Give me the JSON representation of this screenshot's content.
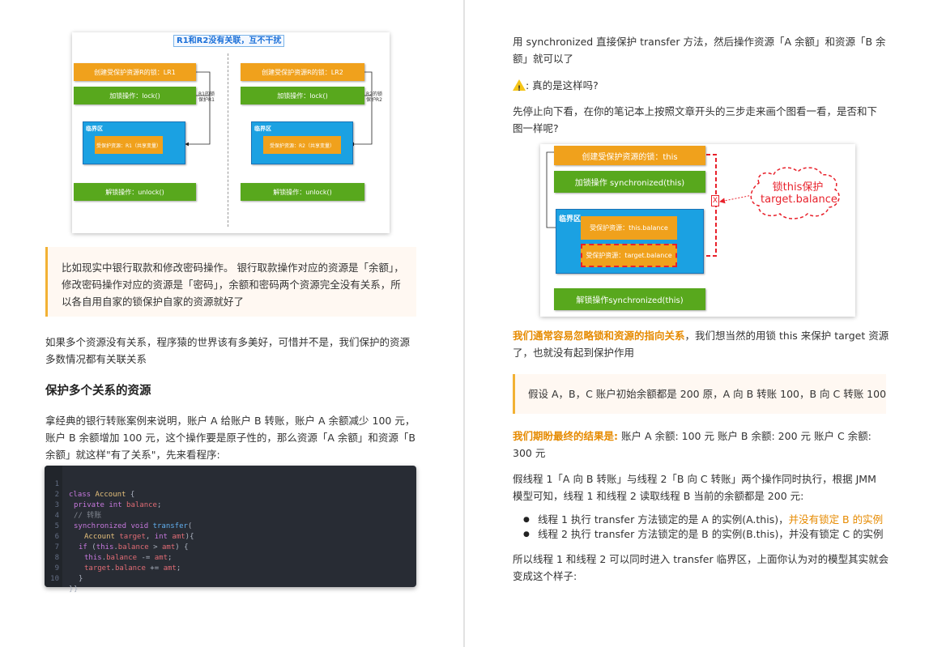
{
  "figure1": {
    "title": "R1和R2没有关联，互不干扰",
    "left": {
      "create_lock": "创建受保护资源R的锁：LR1",
      "lock_op": "加锁操作：lock()",
      "note": [
        "R1的锁",
        "保护R1"
      ],
      "critical": "临界区",
      "resource": "受保护资源：R1（共享变量）",
      "unlock_op": "解锁操作：unlock()"
    },
    "right": {
      "create_lock": "创建受保护资源R的锁：LR2",
      "lock_op": "加锁操作：lock()",
      "note": [
        "R2的锁",
        "保护R2"
      ],
      "critical": "临界区",
      "resource": "受保护资源：R2（共享变量）",
      "unlock_op": "解锁操作：unlock()"
    }
  },
  "quote1": [
    "比如现实中银行取款和修改密码操作。 银行取款操作对应的资源是「余额」，",
    "修改密码操作对应的资源是「密码」，余额和密码两个资源完全没有关系，所",
    "以各自用自家的锁保护自家的资源就好了"
  ],
  "para1": [
    "如果多个资源没有关系，程序猿的世界该有多美好，可惜并不是，我们保护的资源",
    "多数情况都有关联关系"
  ],
  "heading": "保护多个关系的资源",
  "para2": [
    "拿经典的银行转账案例来说明，账户 A 给账户 B 转账，账户 A 余额减少 100 元，",
    "账户 B 余额增加 100 元，这个操作要是原子性的，那么资源「A 余额」和资源「B",
    "余额」就这样\"有了关系\"，先来看程序:"
  ],
  "code": {
    "line_numbers": [
      "1",
      "2",
      "3",
      "4",
      "5",
      "6",
      "7",
      "8",
      "9",
      "10"
    ],
    "l1": [
      "class",
      "Account",
      " {"
    ],
    "l2": [
      "private",
      "int",
      "balance",
      ";"
    ],
    "l3": "// 转账",
    "l4": [
      "synchronized",
      "void",
      "transfer",
      "("
    ],
    "l5": [
      "Account",
      "target",
      ", ",
      "int",
      "amt",
      "){"
    ],
    "l6": [
      "if",
      " (",
      "this",
      ".",
      "balance",
      " > ",
      "amt",
      ") {"
    ],
    "l7": [
      "this",
      ".",
      "balance",
      " -= ",
      "amt",
      ";"
    ],
    "l8": [
      "target",
      ".",
      "balance",
      " += ",
      "amt",
      ";"
    ],
    "l9": "}",
    "l10": "}",
    "l11": "}"
  },
  "right": {
    "para1": [
      "用 synchronized 直接保护 transfer 方法，然后操作资源「A 余额」和资源「B 余",
      "额」就可以了"
    ],
    "question": ": 真的是这样吗?",
    "para2": [
      "先停止向下看，在你的笔记本上按照文章开头的三步走来画个图看一看，是否和下",
      "图一样呢?"
    ],
    "figure2": {
      "create_lock": "创建受保护资源的锁：this",
      "lock_op": "加锁操作 synchronized(this)",
      "critical": "临界区",
      "res1": "受保护资源：this.balance",
      "res2": "受保护资源：target.balance",
      "unlock_op": "解锁操作synchronized(this)",
      "x_mark": "X",
      "cloud": [
        "锁this保护",
        "target.balance"
      ]
    },
    "para3_highlight": "我们通常容易忽略锁和资源的指向关系",
    "para3_rest_line1": "，我们想当然的用锁 this 来保护 target 资源",
    "para3_line2": "了，也就没有起到保护作用",
    "quote2": "假设 A，B，C 账户初始余额都是 200 原，A 向 B 转账 100，B 向 C 转账 100",
    "para4_highlight": "我们期盼最终的结果是:",
    "para4_rest_line1": " 账户 A 余额: 100 元 账户 B 余额: 200 元 账户 C 余额:",
    "para4_line2": "300 元",
    "para5": [
      "假线程 1「A 向 B 转账」与线程 2「B 向 C 转账」两个操作同时执行，根据 JMM",
      "模型可知，线程 1 和线程 2 读取线程 B 当前的余额都是 200 元:"
    ],
    "bullet1_text": "线程 1 执行 transfer 方法锁定的是 A 的实例(A.this)，",
    "bullet1_highlight": "并没有锁定 B 的实例",
    "bullet2": "线程 2 执行 transfer 方法锁定的是 B 的实例(B.this)，并没有锁定 C 的实例",
    "para6": [
      "所以线程 1 和线程 2 可以同时进入 transfer 临界区，上面你认为对的模型其实就会",
      "变成这个样子:"
    ]
  },
  "colors": {
    "orange_box": "#f0a11c",
    "green_box": "#58a81d",
    "blue_box": "#1ba1e2",
    "highlight": "#e68a00",
    "warn_red": "#e8212b"
  }
}
